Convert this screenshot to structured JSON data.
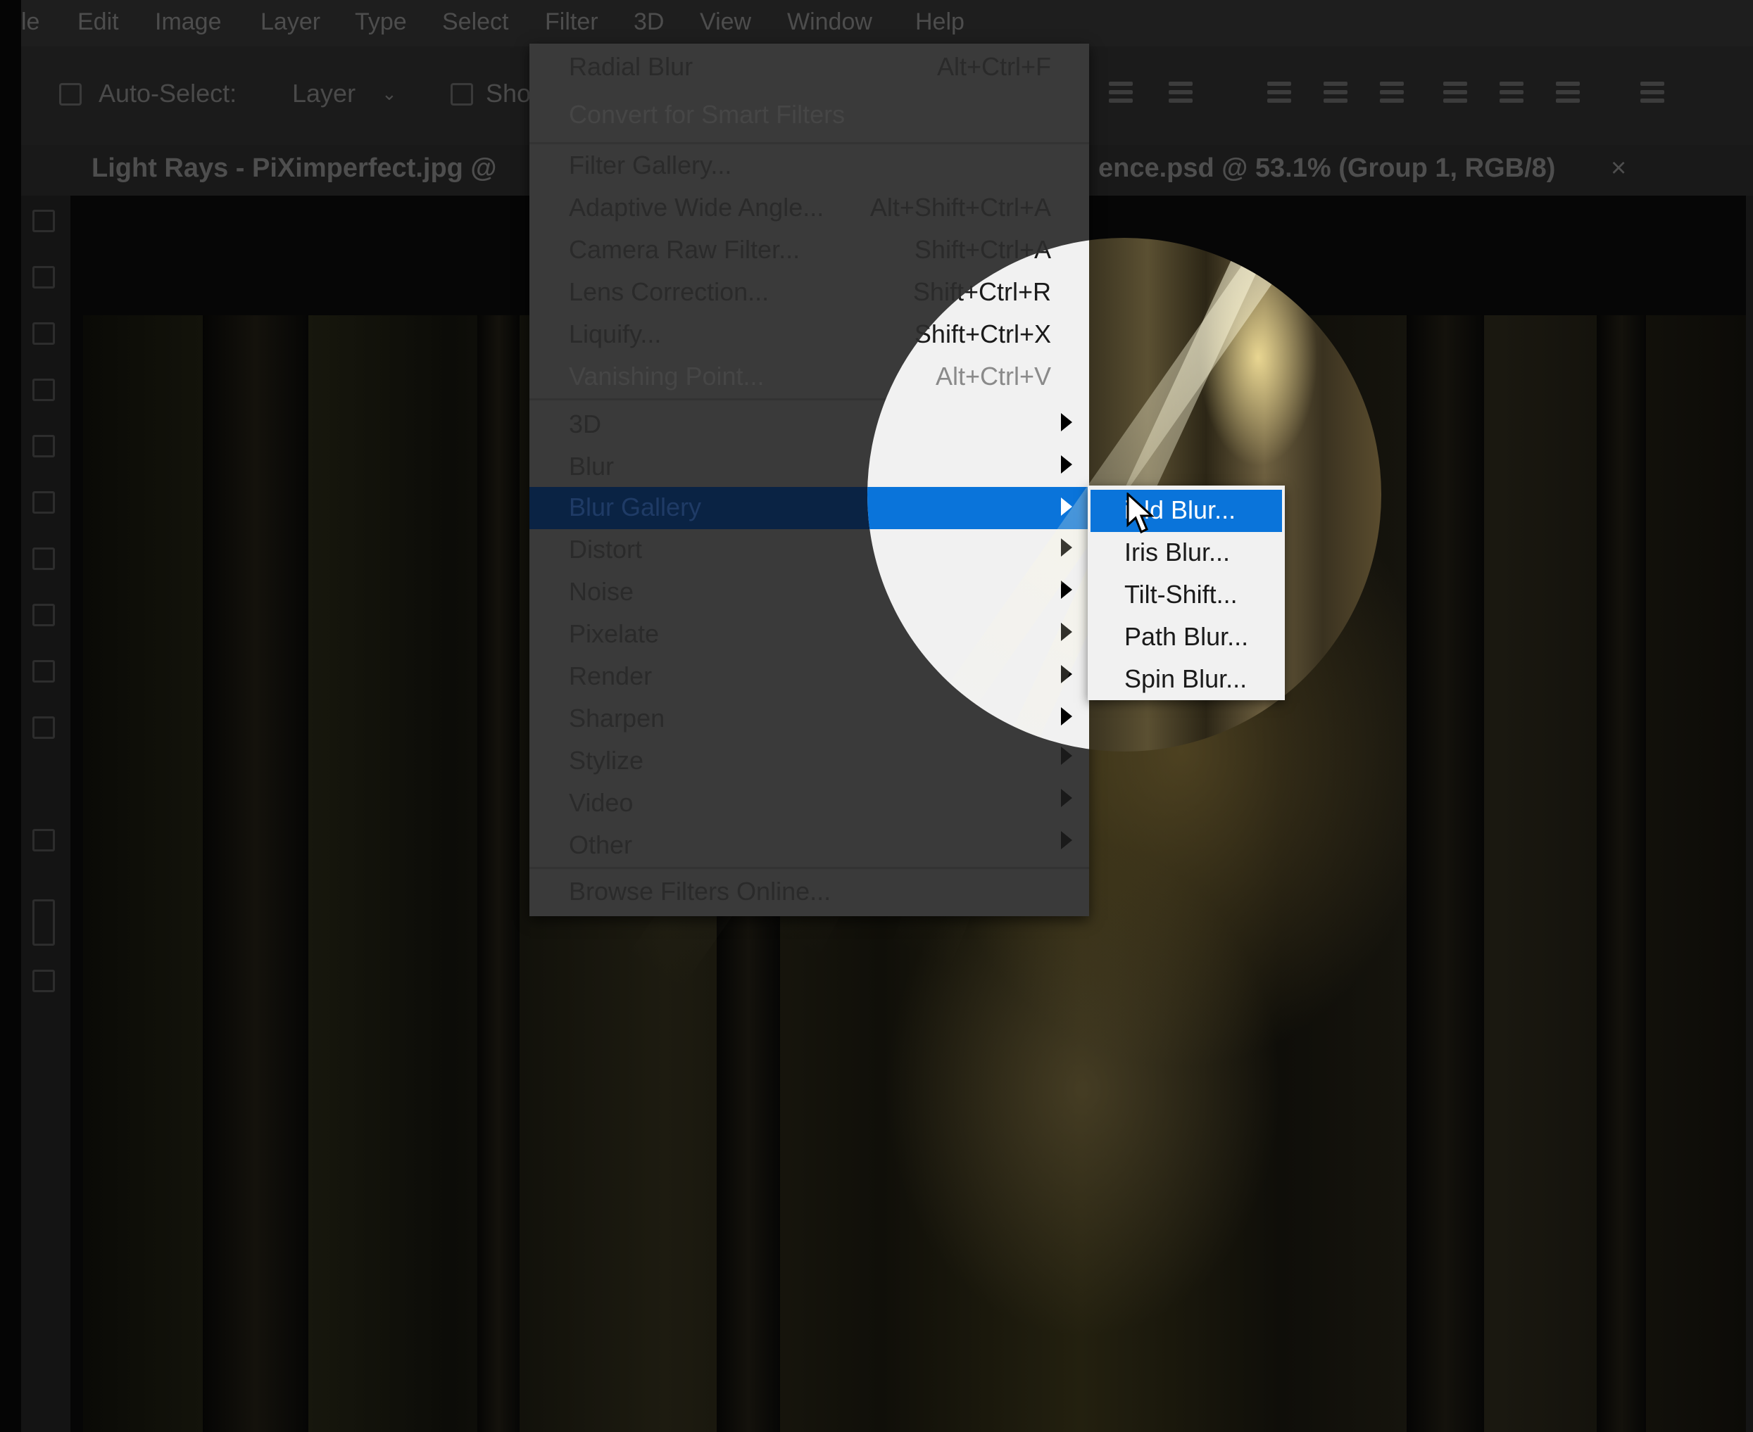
{
  "menubar": {
    "items": [
      "le",
      "Edit",
      "Image",
      "Layer",
      "Type",
      "Select",
      "Filter",
      "3D",
      "View",
      "Window",
      "Help"
    ]
  },
  "options": {
    "auto_select_label": "Auto-Select:",
    "layer_dropdown": "Layer",
    "show_label": "Sho"
  },
  "tabs": {
    "active": "Light Rays - PiXimperfect.jpg @",
    "other": "ence.psd @ 53.1% (Group 1, RGB/8)",
    "close": "×"
  },
  "filter_menu": {
    "last_filter": {
      "label": "Radial Blur",
      "shortcut": "Alt+Ctrl+F"
    },
    "convert": "Convert for Smart Filters",
    "gallery_items": [
      {
        "label": "Filter Gallery...",
        "shortcut": ""
      },
      {
        "label": "Adaptive Wide Angle...",
        "shortcut": "Alt+Shift+Ctrl+A"
      },
      {
        "label": "Camera Raw Filter...",
        "shortcut": "Shift+Ctrl+A"
      },
      {
        "label": "Lens Correction...",
        "shortcut": "Shift+Ctrl+R"
      },
      {
        "label": "Liquify...",
        "shortcut": "Shift+Ctrl+X"
      },
      {
        "label": "Vanishing Point...",
        "shortcut": "Alt+Ctrl+V"
      }
    ],
    "submenus": [
      "3D",
      "Blur",
      "Blur Gallery",
      "Distort",
      "Noise",
      "Pixelate",
      "Render",
      "Sharpen",
      "Stylize",
      "Video",
      "Other"
    ],
    "browse": "Browse Filters Online..."
  },
  "blur_gallery_submenu": {
    "items": [
      "Field Blur...",
      "Iris Blur...",
      "Tilt-Shift...",
      "Path Blur...",
      "Spin Blur..."
    ],
    "selected_visible_text": "ield Blur..."
  },
  "colors": {
    "selection_blue": "#0a74da",
    "menu_bg": "#f1f1f1"
  }
}
